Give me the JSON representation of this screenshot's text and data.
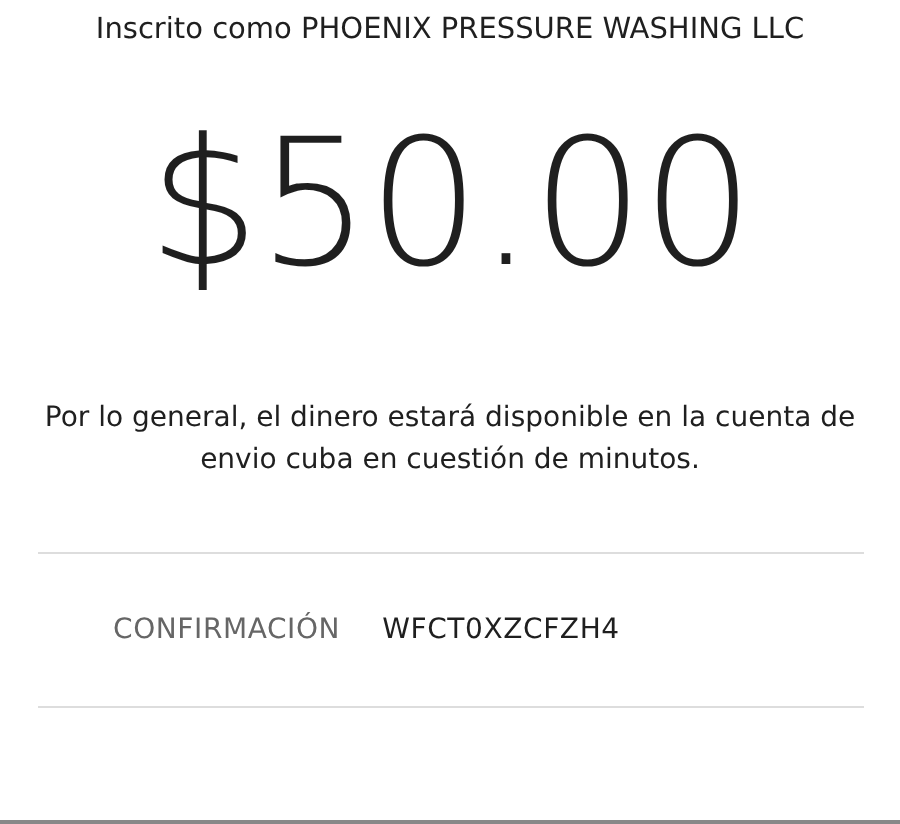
{
  "enrolled_as": "Inscrito como PHOENIX PRESSURE WASHING LLC",
  "amount": "$50.00",
  "message": "Por lo general, el dinero estará disponible en la cuenta de envio cuba en cuestión de minutos.",
  "confirmation": {
    "label": "CONFIRMACIÓN",
    "value": "WFCT0XZCFZH4"
  }
}
